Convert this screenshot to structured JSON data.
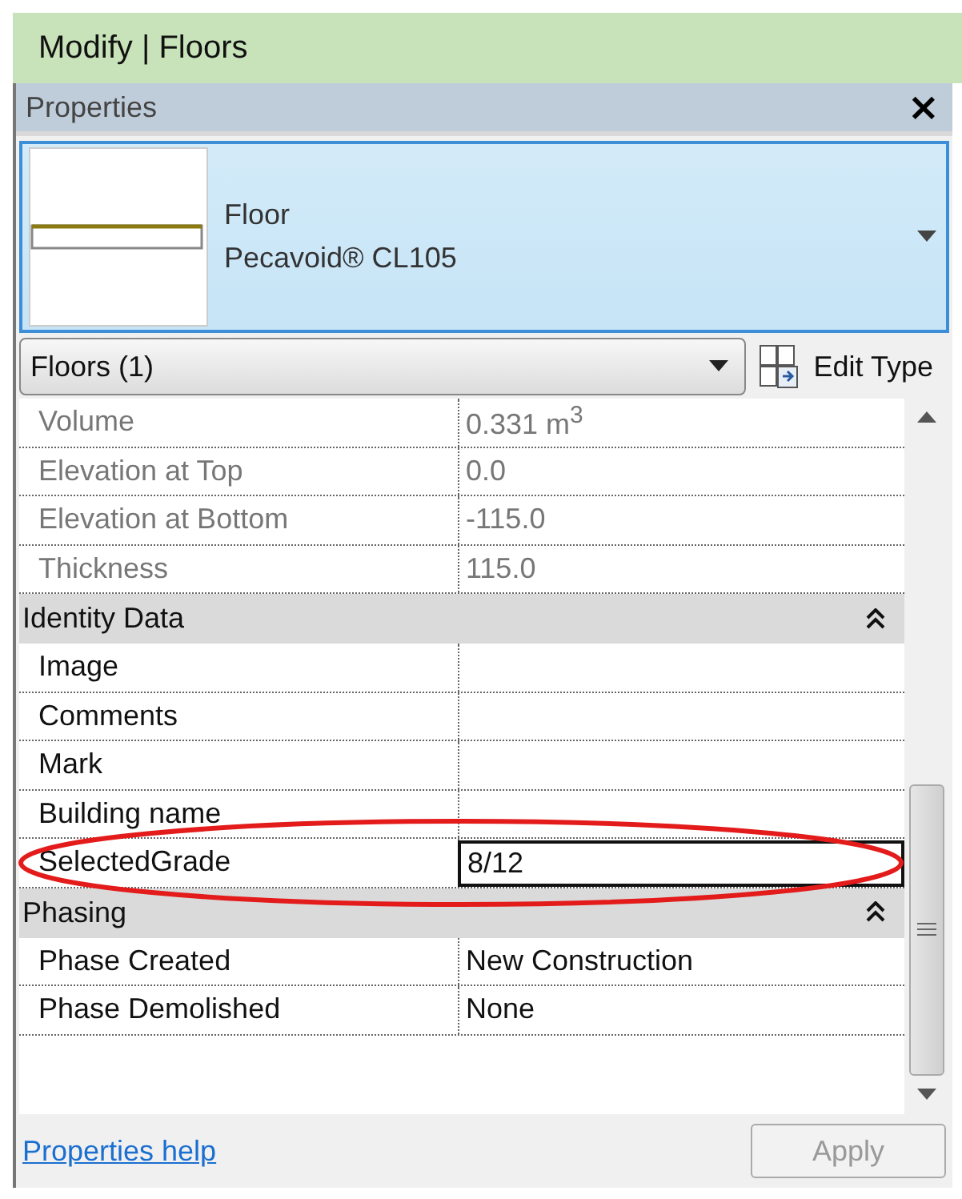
{
  "ribbon_tab": {
    "title": "Modify | Floors"
  },
  "palette": {
    "title": "Properties",
    "close": "×"
  },
  "type_selector": {
    "family": "Floor",
    "type": "Pecavoid® CL105"
  },
  "instance_filter": {
    "value": "Floors (1)",
    "edit_type": "Edit Type"
  },
  "rows": [
    {
      "kind": "property",
      "name": "Volume",
      "value": "0.331 m$^{3}$",
      "disabled": true,
      "editing": false,
      "highlighted": false
    },
    {
      "kind": "property",
      "name": "Elevation at Top",
      "value": "0.0",
      "disabled": true,
      "editing": false,
      "highlighted": false
    },
    {
      "kind": "property",
      "name": "Elevation at Bottom",
      "value": "-115.0",
      "disabled": true,
      "editing": false,
      "highlighted": false
    },
    {
      "kind": "property",
      "name": "Thickness",
      "value": "115.0",
      "disabled": true,
      "editing": false,
      "highlighted": false
    },
    {
      "kind": "section",
      "name": "Identity Data",
      "expanded": true
    },
    {
      "kind": "property",
      "name": "Image",
      "disabled": false,
      "editing": false,
      "highlighted": false
    },
    {
      "kind": "property",
      "name": "Comments",
      "disabled": false,
      "editing": false,
      "highlighted": false
    },
    {
      "kind": "property",
      "name": "Mark",
      "disabled": false,
      "editing": false,
      "highlighted": false
    },
    {
      "kind": "property",
      "name": "Building name",
      "disabled": false,
      "editing": false,
      "highlighted": false
    },
    {
      "kind": "property",
      "name": "SelectedGrade",
      "value": "8/12",
      "disabled": false,
      "editing": true,
      "highlighted": true
    },
    {
      "kind": "section",
      "name": "Phasing",
      "expanded": true
    },
    {
      "kind": "property",
      "name": "Phase Created",
      "value": "New Construction",
      "disabled": false,
      "editing": false,
      "highlighted": false
    },
    {
      "kind": "property",
      "name": "Phase Demolished",
      "value": "None",
      "disabled": false,
      "editing": false,
      "highlighted": false
    }
  ],
  "footer": {
    "help_link": "Properties help",
    "apply": {
      "label": "Apply",
      "disabled": true
    }
  }
}
